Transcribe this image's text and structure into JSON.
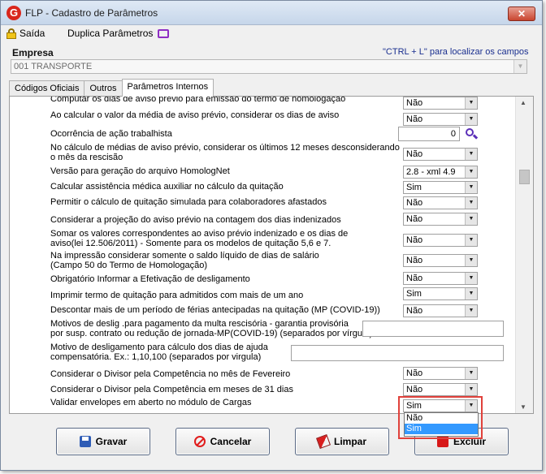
{
  "window": {
    "title": "FLP - Cadastro de Parâmetros",
    "close_glyph": "✕"
  },
  "toolbar": {
    "saida_label": "Saída",
    "duplica_label": "Duplica Parâmetros"
  },
  "empresa": {
    "label": "Empresa",
    "hint": "\"CTRL + L\" para localizar os campos",
    "value": "001 TRANSPORTE"
  },
  "tabs": [
    {
      "label": "Códigos Oficiais",
      "active": false
    },
    {
      "label": "Outros",
      "active": false
    },
    {
      "label": "Parâmetros Internos",
      "active": true
    }
  ],
  "rows": [
    {
      "label": "Computar os dias de aviso prévio para emissão do termo de homologação",
      "type": "select",
      "value": "Não"
    },
    {
      "label": "Ao calcular o valor da média de aviso prévio, considerar os dias de aviso",
      "type": "select",
      "value": "Não"
    },
    {
      "label": "Ocorrência de ação trabalhista",
      "type": "number",
      "value": "0"
    },
    {
      "label": "No cálculo de médias de aviso prévio, considerar os últimos 12 meses desconsiderando\no mês da rescisão",
      "type": "select",
      "value": "Não"
    },
    {
      "label": "Versão para geração do arquivo HomologNet",
      "type": "select",
      "value": "2.8 - xml 4.9"
    },
    {
      "label": "Calcular assistência médica auxiliar no cálculo da quitação",
      "type": "select",
      "value": "Sim"
    },
    {
      "label": "Permitir o cálculo de quitação simulada para colaboradores afastados",
      "type": "select",
      "value": "Não"
    },
    {
      "label": "Considerar a projeção do aviso prévio na contagem dos dias indenizados",
      "type": "select",
      "value": "Não"
    },
    {
      "label": "Somar os valores correspondentes ao aviso prévio indenizado e os dias de\naviso(lei 12.506/2011)  - Somente para os modelos de quitação 5,6 e 7.",
      "type": "select",
      "value": "Não"
    },
    {
      "label": "Na impressão considerar somente o saldo líquido de dias de salário\n(Campo 50 do Termo de Homologação)",
      "type": "select",
      "value": "Não"
    },
    {
      "label": "Obrigatório Informar a Efetivação de desligamento",
      "type": "select",
      "value": "Não"
    },
    {
      "label": "Imprimir termo de quitação para admitidos com mais de um ano",
      "type": "select",
      "value": "Sim"
    },
    {
      "label": "Descontar mais de um período de férias antecipadas na quitação (MP (COVID-19))",
      "type": "select",
      "value": "Não"
    },
    {
      "label": "Motivos de deslig .para pagamento da multa rescisória - garantia provisória\npor susp. contrato ou redução de jornada-MP(COVID-19) (separados por vírgula)",
      "type": "text",
      "value": ""
    },
    {
      "label": "Motivo de desligamento para cálculo dos dias de ajuda\ncompensatória. Ex.: 1,10,100 (separados por virgula)",
      "type": "text",
      "value": ""
    },
    {
      "label": "Considerar o Divisor pela Competência no mês de Fevereiro",
      "type": "select",
      "value": "Não"
    },
    {
      "label": "Considerar o Divisor pela Competência em meses de 31 dias",
      "type": "select",
      "value": "Não"
    },
    {
      "label": "Validar envelopes em aberto no módulo de Cargas",
      "type": "select",
      "value": "Sim"
    }
  ],
  "dropdown_popup": {
    "options": [
      "Não",
      "Sim"
    ],
    "selected": "Sim"
  },
  "buttons": {
    "gravar": "Gravar",
    "cancelar": "Cancelar",
    "limpar": "Limpar",
    "excluir": "Excluir"
  },
  "icons": {
    "app": "flp-logo-icon",
    "saida": "lock-icon",
    "duplica": "monitor-icon",
    "search": "magnifier-icon",
    "gravar": "floppy-disk-icon",
    "cancelar": "cancel-icon",
    "limpar": "eraser-icon",
    "excluir": "trash-icon"
  },
  "colors": {
    "hint": "#1a2f8f",
    "highlight": "#e0413b",
    "selection": "#3399ff"
  }
}
